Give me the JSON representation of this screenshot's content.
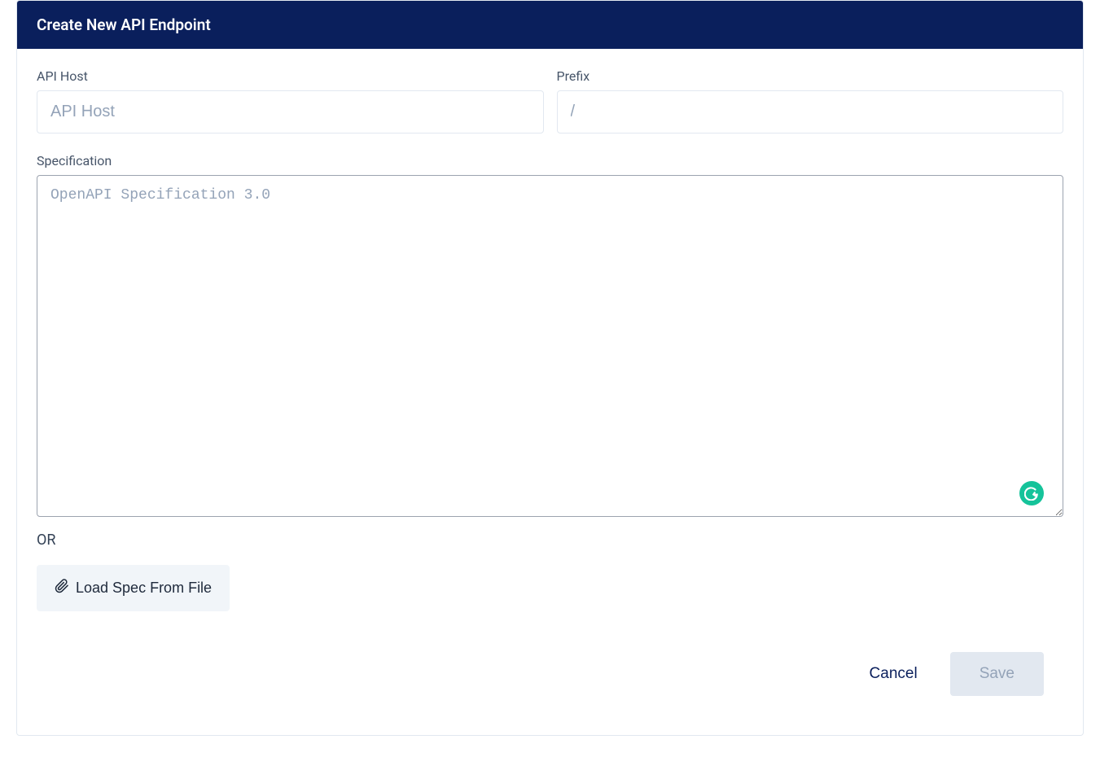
{
  "header": {
    "title": "Create New API Endpoint"
  },
  "form": {
    "apiHost": {
      "label": "API Host",
      "placeholder": "API Host",
      "value": ""
    },
    "prefix": {
      "label": "Prefix",
      "placeholder": "/",
      "value": ""
    },
    "specification": {
      "label": "Specification",
      "placeholder": "OpenAPI Specification 3.0",
      "value": ""
    },
    "orDivider": "OR",
    "loadFromFile": {
      "label": "Load Spec From File"
    }
  },
  "footer": {
    "cancel": "Cancel",
    "save": "Save"
  },
  "grammarly": {
    "glyph": "G"
  }
}
